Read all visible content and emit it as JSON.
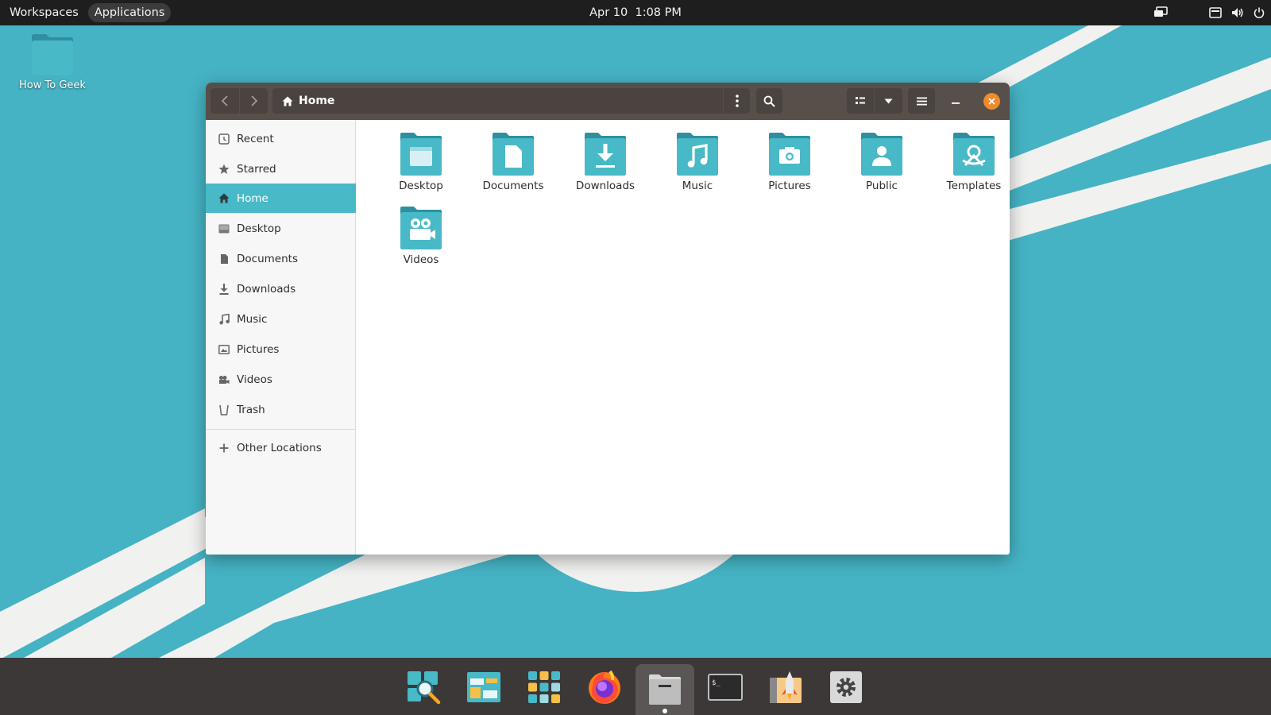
{
  "colors": {
    "accent": "#48b9c7",
    "folder": "#3a9fb0",
    "headerbar": "#574f4a",
    "close": "#f08a2a",
    "panel": "#1e1e1e",
    "dock": "#3b3837"
  },
  "panel": {
    "workspaces_label": "Workspaces",
    "applications_label": "Applications",
    "date": "Apr 10",
    "time": "1:08 PM"
  },
  "desktop": {
    "folder_label": "How To Geek"
  },
  "window": {
    "path_label": "Home",
    "sidebar": {
      "items": [
        {
          "label": "Recent",
          "icon": "recent-icon"
        },
        {
          "label": "Starred",
          "icon": "star-icon"
        },
        {
          "label": "Home",
          "icon": "home-icon"
        },
        {
          "label": "Desktop",
          "icon": "desktop-icon"
        },
        {
          "label": "Documents",
          "icon": "document-icon"
        },
        {
          "label": "Downloads",
          "icon": "download-icon"
        },
        {
          "label": "Music",
          "icon": "music-icon"
        },
        {
          "label": "Pictures",
          "icon": "pictures-icon"
        },
        {
          "label": "Videos",
          "icon": "videos-icon"
        },
        {
          "label": "Trash",
          "icon": "trash-icon"
        }
      ],
      "other_locations": "Other Locations"
    },
    "folders": [
      {
        "label": "Desktop",
        "icon": "desktop-folder-icon"
      },
      {
        "label": "Documents",
        "icon": "documents-folder-icon"
      },
      {
        "label": "Downloads",
        "icon": "downloads-folder-icon"
      },
      {
        "label": "Music",
        "icon": "music-folder-icon"
      },
      {
        "label": "Pictures",
        "icon": "pictures-folder-icon"
      },
      {
        "label": "Public",
        "icon": "public-folder-icon"
      },
      {
        "label": "Templates",
        "icon": "templates-folder-icon"
      },
      {
        "label": "Videos",
        "icon": "videos-folder-icon"
      }
    ]
  },
  "dock": {
    "items": [
      {
        "icon": "search-app-icon"
      },
      {
        "icon": "workspaces-app-icon"
      },
      {
        "icon": "app-grid-icon"
      },
      {
        "icon": "firefox-icon"
      },
      {
        "icon": "files-app-icon",
        "active": true
      },
      {
        "icon": "terminal-icon"
      },
      {
        "icon": "pop-shop-icon"
      },
      {
        "icon": "settings-app-icon"
      }
    ]
  }
}
